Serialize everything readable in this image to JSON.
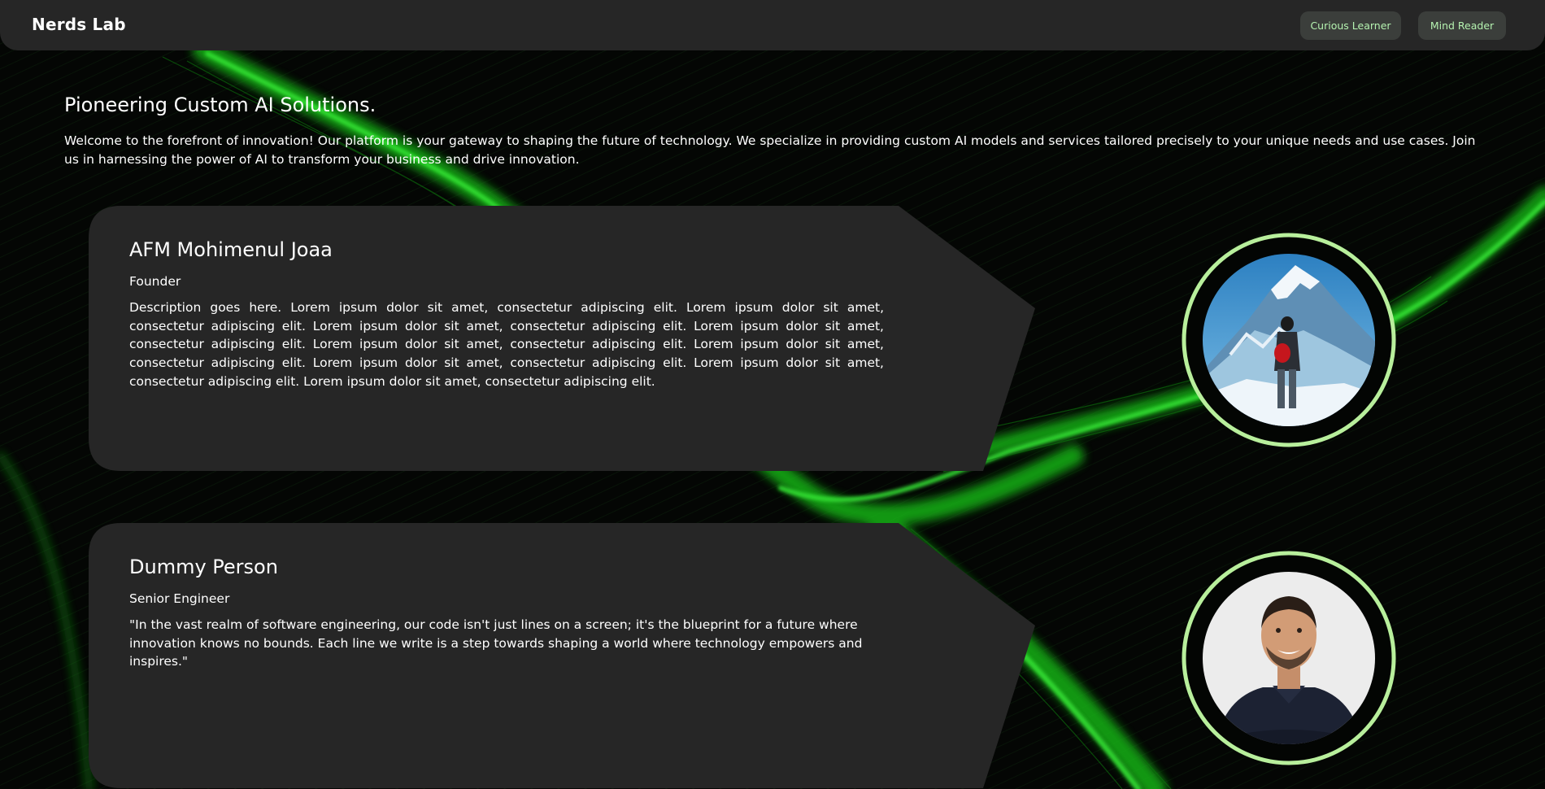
{
  "navbar": {
    "brand": "Nerds Lab",
    "buttons": [
      {
        "label": "Curious Learner"
      },
      {
        "label": "Mind Reader"
      }
    ]
  },
  "hero": {
    "title": "Pioneering Custom AI Solutions.",
    "text": "Welcome to the forefront of innovation! Our platform is your gateway to shaping the future of technology. We specialize in providing custom AI models and services tailored precisely to your unique needs and use cases. Join us in harnessing the power of AI to transform your business and drive innovation."
  },
  "team": [
    {
      "name": "AFM Mohimenul Joaa",
      "role": "Founder",
      "description": "Description goes here. Lorem ipsum dolor sit amet, consectetur adipiscing elit. Lorem ipsum dolor sit amet, consectetur adipiscing elit. Lorem ipsum dolor sit amet, consectetur adipiscing elit. Lorem ipsum dolor sit amet, consectetur adipiscing elit. Lorem ipsum dolor sit amet, consectetur adipiscing elit. Lorem ipsum dolor sit amet, consectetur adipiscing elit. Lorem ipsum dolor sit amet, consectetur adipiscing elit. Lorem ipsum dolor sit amet, consectetur adipiscing elit. Lorem ipsum dolor sit amet, consectetur adipiscing elit.",
      "photo": "mountain-hiker-photo"
    },
    {
      "name": "Dummy Person",
      "role": "Senior Engineer",
      "description": "\"In the vast realm of software engineering, our code isn't just lines on a screen; it's the blueprint for a future where innovation knows no bounds. Each line we write is a step towards shaping a world where technology empowers and inspires.\"",
      "photo": "smiling-man-portrait-photo"
    }
  ],
  "colors": {
    "background": "#040604",
    "panel": "#262626",
    "accent_green": "#b5f2b0",
    "ring": "#b8ef9c",
    "swirl": "#1fd41f"
  }
}
